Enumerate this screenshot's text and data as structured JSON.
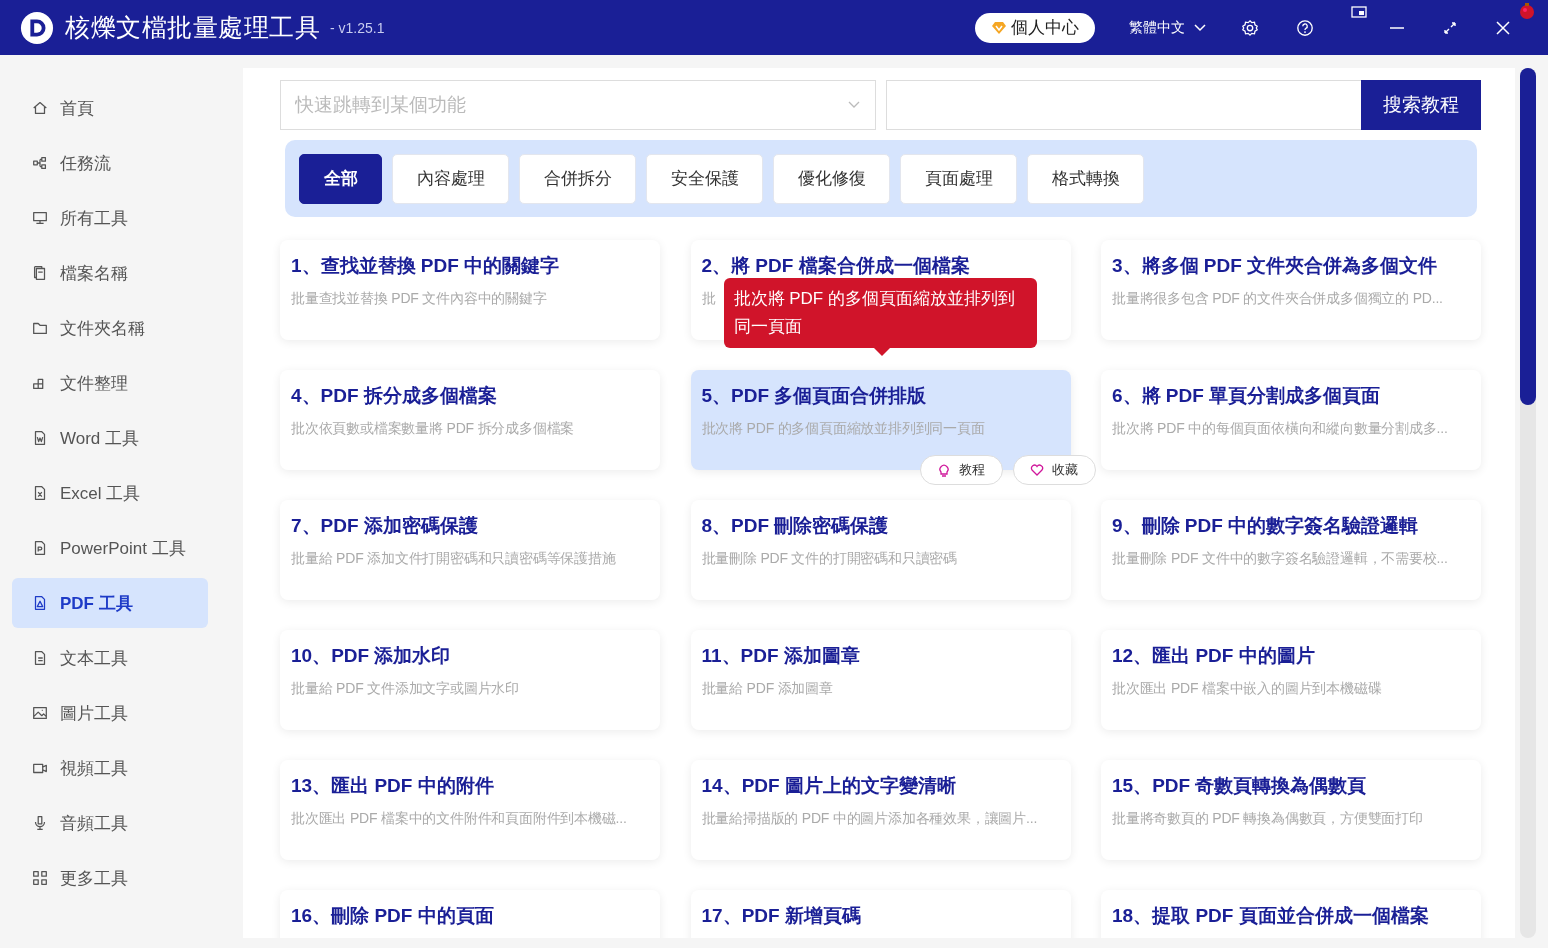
{
  "window": {
    "title": "核爍文檔批量處理工具",
    "version": "- v1.25.1",
    "user_center": "個人中心",
    "language": "繁體中文"
  },
  "sidebar": {
    "items": [
      {
        "label": "首頁",
        "selected": false
      },
      {
        "label": "任務流",
        "selected": false
      },
      {
        "label": "所有工具",
        "selected": false
      },
      {
        "label": "檔案名稱",
        "selected": false
      },
      {
        "label": "文件夾名稱",
        "selected": false
      },
      {
        "label": "文件整理",
        "selected": false
      },
      {
        "label": "Word 工具",
        "selected": false
      },
      {
        "label": "Excel 工具",
        "selected": false
      },
      {
        "label": "PowerPoint 工具",
        "selected": false
      },
      {
        "label": "PDF 工具",
        "selected": true
      },
      {
        "label": "文本工具",
        "selected": false
      },
      {
        "label": "圖片工具",
        "selected": false
      },
      {
        "label": "視頻工具",
        "selected": false
      },
      {
        "label": "音頻工具",
        "selected": false
      },
      {
        "label": "更多工具",
        "selected": false
      }
    ]
  },
  "search": {
    "placeholder": "快速跳轉到某個功能",
    "button": "搜索教程"
  },
  "tabs": [
    {
      "label": "全部",
      "selected": true
    },
    {
      "label": "內容處理",
      "selected": false
    },
    {
      "label": "合併拆分",
      "selected": false
    },
    {
      "label": "安全保護",
      "selected": false
    },
    {
      "label": "優化修復",
      "selected": false
    },
    {
      "label": "頁面處理",
      "selected": false
    },
    {
      "label": "格式轉換",
      "selected": false
    }
  ],
  "cards": [
    {
      "title": "1、查找並替換 PDF 中的關鍵字",
      "description": "批量查找並替換 PDF 文件內容中的關鍵字",
      "hovered": false
    },
    {
      "title": "2、將 PDF 檔案合併成一個檔案",
      "description": "批",
      "hovered": false
    },
    {
      "title": "3、將多個 PDF 文件夾合併為多個文件",
      "description": "批量將很多包含 PDF 的文件夾合併成多個獨立的 PD...",
      "hovered": false
    },
    {
      "title": "4、PDF 拆分成多個檔案",
      "description": "批次依頁數或檔案數量將 PDF 拆分成多個檔案",
      "hovered": false
    },
    {
      "title": "5、PDF 多個頁面合併排版",
      "description": "批次將 PDF 的多個頁面縮放並排列到同一頁面",
      "hovered": true,
      "tooltip": "批次將 PDF 的多個頁面縮放並排列到同一頁面",
      "actions": [
        "教程",
        "收藏"
      ]
    },
    {
      "title": "6、將 PDF 單頁分割成多個頁面",
      "description": "批次將 PDF 中的每個頁面依橫向和縱向數量分割成多...",
      "hovered": false
    },
    {
      "title": "7、PDF 添加密碼保護",
      "description": "批量給 PDF 添加文件打開密碼和只讀密碼等保護措施",
      "hovered": false
    },
    {
      "title": "8、PDF 刪除密碼保護",
      "description": "批量刪除 PDF 文件的打開密碼和只讀密碼",
      "hovered": false
    },
    {
      "title": "9、刪除 PDF 中的數字簽名驗證邏輯",
      "description": "批量刪除 PDF 文件中的數字簽名驗證邏輯，不需要校...",
      "hovered": false
    },
    {
      "title": "10、PDF 添加水印",
      "description": "批量給 PDF 文件添加文字或圖片水印",
      "hovered": false
    },
    {
      "title": "11、PDF 添加圖章",
      "description": "批量給 PDF 添加圖章",
      "hovered": false
    },
    {
      "title": "12、匯出 PDF 中的圖片",
      "description": "批次匯出 PDF 檔案中嵌入的圖片到本機磁碟",
      "hovered": false
    },
    {
      "title": "13、匯出 PDF 中的附件",
      "description": "批次匯出 PDF 檔案中的文件附件和頁面附件到本機磁...",
      "hovered": false
    },
    {
      "title": "14、PDF 圖片上的文字變清晰",
      "description": "批量給掃描版的 PDF 中的圖片添加各種效果，讓圖片...",
      "hovered": false
    },
    {
      "title": "15、PDF 奇數頁轉換為偶數頁",
      "description": "批量將奇數頁的 PDF 轉換為偶數頁，方便雙面打印",
      "hovered": false
    },
    {
      "title": "16、刪除 PDF 中的頁面",
      "hovered": false
    },
    {
      "title": "17、PDF 新增頁碼",
      "hovered": false
    },
    {
      "title": "18、提取 PDF 頁面並合併成一個檔案",
      "hovered": false
    }
  ]
}
